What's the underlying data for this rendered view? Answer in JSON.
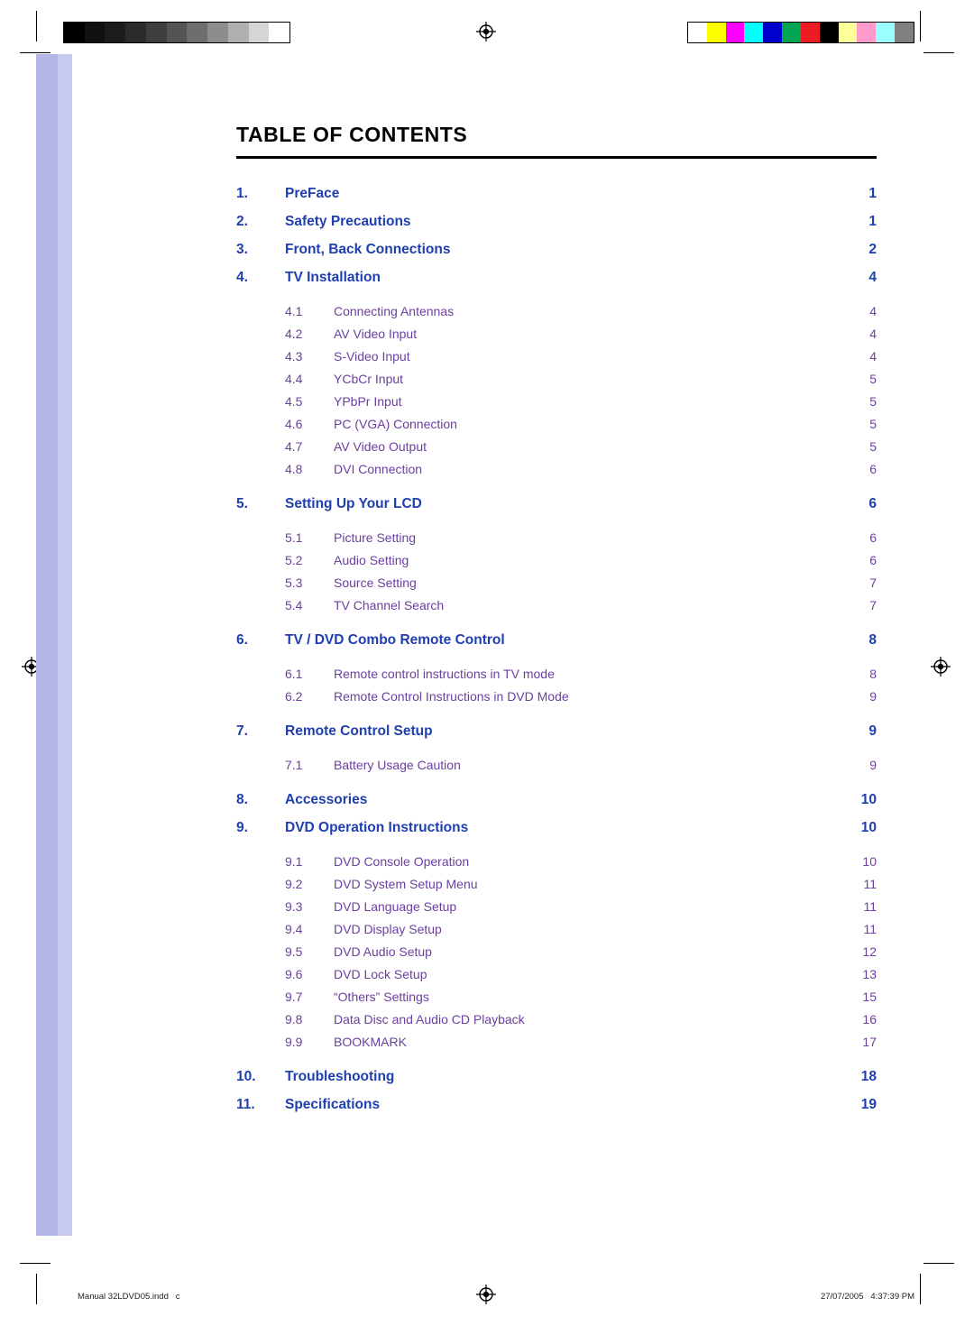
{
  "page": {
    "title": "TABLE OF CONTENTS",
    "colors": {
      "level1": "#1f3fb0",
      "level2": "#6b3fa0",
      "band": "#b5b6e8",
      "rule": "#000000"
    }
  },
  "toc": {
    "entries": [
      {
        "level": 1,
        "num": "1.",
        "label": "PreFace",
        "page": "1"
      },
      {
        "level": 1,
        "num": "2.",
        "label": "Safety Precautions",
        "page": "1"
      },
      {
        "level": 1,
        "num": "3.",
        "label": "Front, Back Connections",
        "page": "2"
      },
      {
        "level": 1,
        "num": "4.",
        "label": "TV Installation",
        "page": "4"
      },
      {
        "level": 2,
        "num": "4.1",
        "label": "Connecting Antennas",
        "page": "4"
      },
      {
        "level": 2,
        "num": "4.2",
        "label": "AV Video Input",
        "page": "4"
      },
      {
        "level": 2,
        "num": "4.3",
        "label": "S-Video Input",
        "page": "4"
      },
      {
        "level": 2,
        "num": "4.4",
        "label": "YCbCr Input",
        "page": "5"
      },
      {
        "level": 2,
        "num": "4.5",
        "label": "YPbPr Input",
        "page": "5"
      },
      {
        "level": 2,
        "num": "4.6",
        "label": "PC (VGA) Connection",
        "page": "5"
      },
      {
        "level": 2,
        "num": "4.7",
        "label": "AV Video Output",
        "page": "5"
      },
      {
        "level": 2,
        "num": "4.8",
        "label": "DVI Connection",
        "page": "6"
      },
      {
        "level": 1,
        "num": "5.",
        "label": "Setting Up Your LCD",
        "page": "6"
      },
      {
        "level": 2,
        "num": "5.1",
        "label": "Picture Setting",
        "page": "6"
      },
      {
        "level": 2,
        "num": "5.2",
        "label": "Audio Setting",
        "page": "6"
      },
      {
        "level": 2,
        "num": "5.3",
        "label": "Source Setting",
        "page": "7"
      },
      {
        "level": 2,
        "num": "5.4",
        "label": "TV Channel Search",
        "page": "7"
      },
      {
        "level": 1,
        "num": "6.",
        "label": "TV / DVD Combo Remote Control",
        "page": "8"
      },
      {
        "level": 2,
        "num": "6.1",
        "label": "Remote control instructions in TV mode",
        "page": "8"
      },
      {
        "level": 2,
        "num": "6.2",
        "label": "Remote Control Instructions in DVD Mode",
        "page": "9"
      },
      {
        "level": 1,
        "num": "7.",
        "label": "Remote Control Setup",
        "page": "9"
      },
      {
        "level": 2,
        "num": "7.1",
        "label": "Battery Usage Caution",
        "page": "9"
      },
      {
        "level": 1,
        "num": "8.",
        "label": "Accessories",
        "page": "10"
      },
      {
        "level": 1,
        "num": "9.",
        "label": "DVD Operation Instructions",
        "page": "10"
      },
      {
        "level": 2,
        "num": "9.1",
        "label": "DVD Console Operation",
        "page": "10"
      },
      {
        "level": 2,
        "num": "9.2",
        "label": "DVD System Setup Menu",
        "page": "11"
      },
      {
        "level": 2,
        "num": "9.3",
        "label": "DVD  Language Setup",
        "page": "11"
      },
      {
        "level": 2,
        "num": "9.4",
        "label": "DVD Display Setup",
        "page": "11"
      },
      {
        "level": 2,
        "num": "9.5",
        "label": "DVD Audio Setup",
        "page": "12"
      },
      {
        "level": 2,
        "num": "9.6",
        "label": "DVD Lock Setup",
        "page": "13"
      },
      {
        "level": 2,
        "num": "9.7",
        "label": "“Others” Settings",
        "page": "15"
      },
      {
        "level": 2,
        "num": "9.8",
        "label": "Data Disc and Audio CD Playback",
        "page": "16"
      },
      {
        "level": 2,
        "num": "9.9",
        "label": "BOOKMARK",
        "page": "17"
      },
      {
        "level": 1,
        "num": "10.",
        "label": "Troubleshooting",
        "page": "18"
      },
      {
        "level": 1,
        "num": "11.",
        "label": "Specifications",
        "page": "19"
      }
    ]
  },
  "footer": {
    "left": "Manual 32LDVD05.indd   c",
    "right": "27/07/2005   4:37:39 PM"
  },
  "print_marks": {
    "grayscale_swatches": [
      "#000000",
      "#111111",
      "#1c1c1c",
      "#2b2b2b",
      "#3d3d3d",
      "#545454",
      "#6e6e6e",
      "#8d8d8d",
      "#b0b0b0",
      "#d5d5d5",
      "#ffffff"
    ],
    "color_swatches": [
      "#ffffff",
      "#ffff00",
      "#ff00ff",
      "#00ffff",
      "#0000cc",
      "#00a651",
      "#ed1c24",
      "#000000",
      "#ffff99",
      "#ff99cc",
      "#99ffff",
      "#808080"
    ]
  }
}
